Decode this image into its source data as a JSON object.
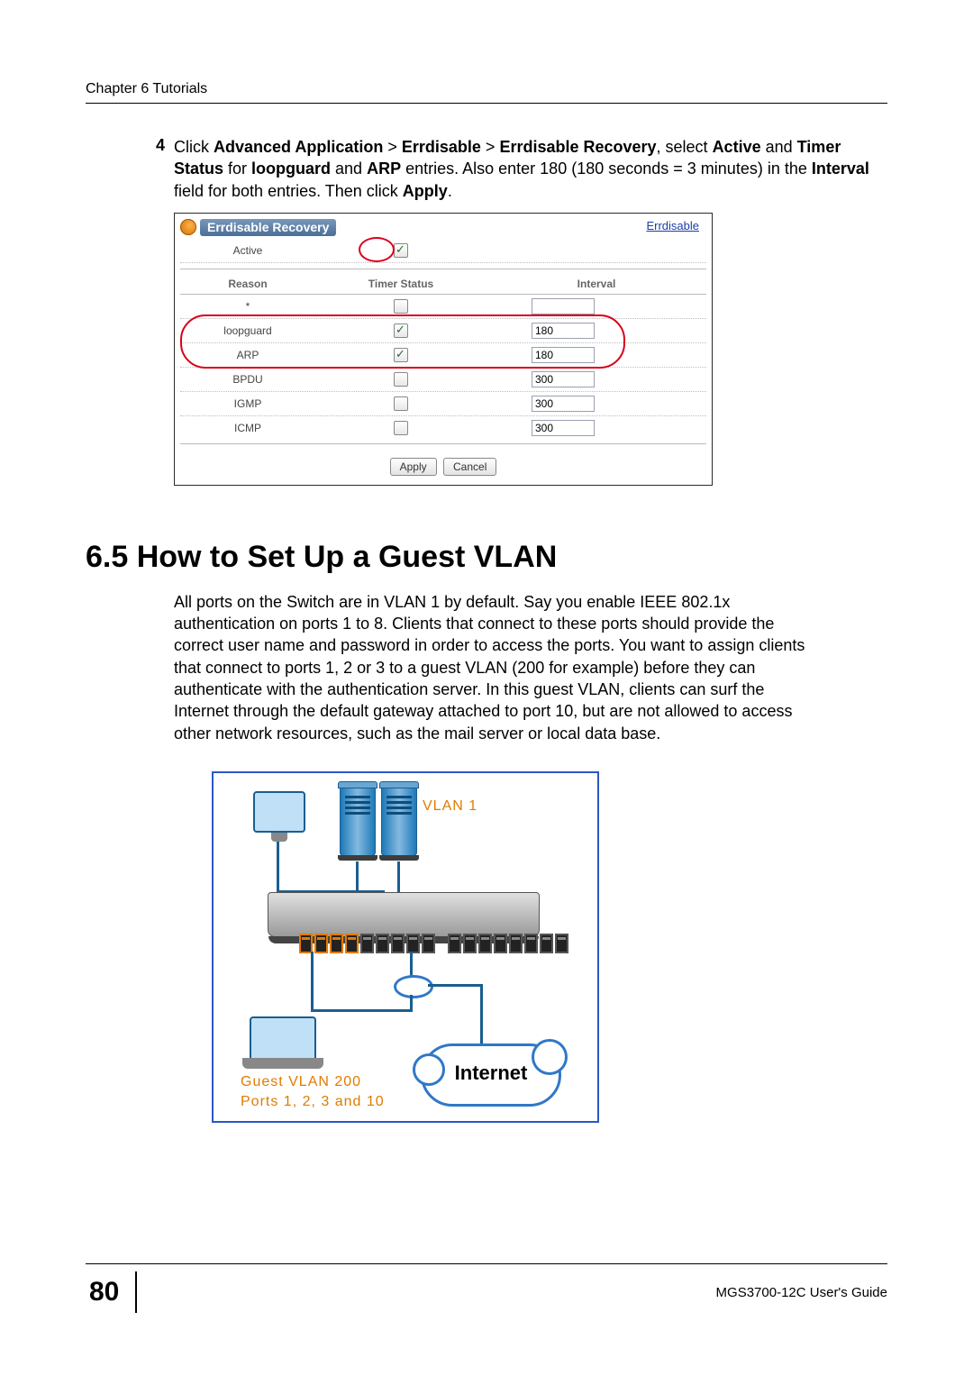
{
  "header": {
    "chapter": "Chapter 6 Tutorials"
  },
  "step": {
    "number": "4",
    "text_a": "Click ",
    "bold1": "Advanced Application",
    "sep1": " > ",
    "bold2": "Errdisable",
    "sep2": " > ",
    "bold3": "Errdisable Recovery",
    "text_b": ", select ",
    "bold4": "Active",
    "text_c": " and ",
    "bold5": "Timer Status",
    "text_d": " for ",
    "bold6": "loopguard",
    "text_e": " and ",
    "bold7": "ARP",
    "text_f": " entries. Also enter 180 (180 seconds = 3 minutes) in the ",
    "bold8": "Interval",
    "text_g": " field for both entries. Then click ",
    "bold9": "Apply",
    "text_h": "."
  },
  "ui": {
    "title": "Errdisable Recovery",
    "link": "Errdisable",
    "active_label": "Active",
    "active_checked": true,
    "columns": {
      "reason": "Reason",
      "timer": "Timer Status",
      "interval": "Interval"
    },
    "rows": [
      {
        "reason": "*",
        "checked": false,
        "interval": ""
      },
      {
        "reason": "loopguard",
        "checked": true,
        "interval": "180"
      },
      {
        "reason": "ARP",
        "checked": true,
        "interval": "180"
      },
      {
        "reason": "BPDU",
        "checked": false,
        "interval": "300"
      },
      {
        "reason": "IGMP",
        "checked": false,
        "interval": "300"
      },
      {
        "reason": "ICMP",
        "checked": false,
        "interval": "300"
      }
    ],
    "buttons": {
      "apply": "Apply",
      "cancel": "Cancel"
    }
  },
  "section": {
    "heading": "6.5  How to Set Up a Guest VLAN",
    "paragraph": "All ports on the Switch are in VLAN 1 by default. Say you enable IEEE 802.1x authentication on ports 1 to 8. Clients that connect to these ports should provide the correct user name and password in order to access the ports. You want to assign clients that connect to ports 1, 2 or 3 to a guest VLAN (200 for example) before they can authenticate with the authentication server. In this guest VLAN, clients can surf the Internet through the default gateway attached to port 10, but are not allowed to access other network resources, such as the mail server or local data base."
  },
  "diagram": {
    "vlan1": "VLAN 1",
    "guest_line1": "Guest VLAN 200",
    "guest_line2": "Ports 1, 2, 3 and 10",
    "internet": "Internet"
  },
  "footer": {
    "page": "80",
    "guide": "MGS3700-12C User's Guide"
  }
}
